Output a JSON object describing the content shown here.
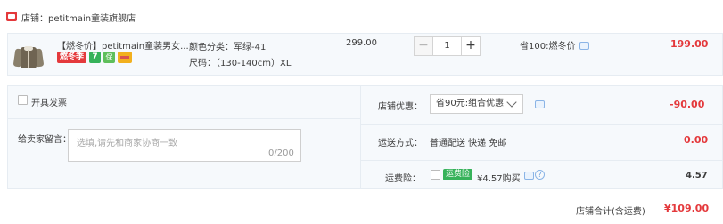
{
  "shop": {
    "label": "店铺：petitmain童装旗舰店"
  },
  "item": {
    "title": "【燃冬价】petitmain童装男女...",
    "tags": {
      "sale": "燃冬季",
      "seven": "7",
      "guarantee": "保"
    },
    "sku_color": "颜色分类：军绿-41",
    "sku_size": "尺码：（130-140cm）XL",
    "unit_price": "299.00",
    "quantity": "1",
    "minus_label": "−",
    "plus_label": "+",
    "saving": "省100:燃冬价",
    "subtotal": "199.00"
  },
  "order": {
    "invoice_label": "开具发票",
    "message_label": "给卖家留言：",
    "message_placeholder": "选填,请先和商家协商一致",
    "message_counter": "0/200",
    "discount_label": "店铺优惠：",
    "discount_selected": "省90元:组合优惠",
    "discount_amount": "-90.00",
    "shipping_label": "运送方式：",
    "shipping_value": "普通配送 快递 免邮",
    "shipping_amount": "0.00",
    "insurance_label": "运费险：",
    "insurance_tag": "运费险",
    "insurance_price": "¥4.57购买",
    "insurance_amount": "4.57",
    "help_symbol": "?",
    "total_label": "店铺合计(含运费)",
    "total_amount": "¥109.00"
  },
  "colors": {
    "accent_red": "#e4393c",
    "panel_bg": "#f6f9fc",
    "badge_green": "#36b25a"
  }
}
